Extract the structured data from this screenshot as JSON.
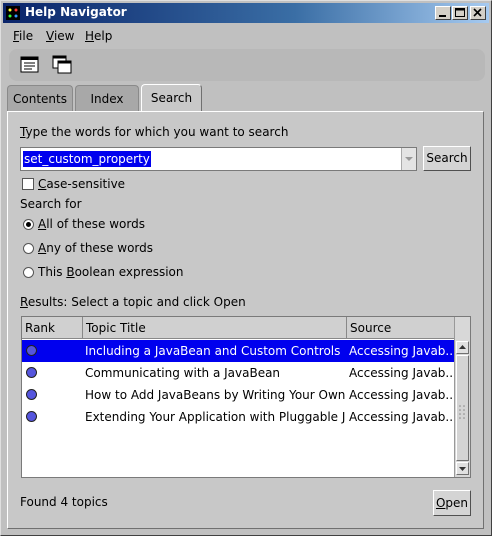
{
  "window": {
    "title": "Help Navigator",
    "colors": {
      "titlebar_start": "#0a246a",
      "selection": "#0000ee",
      "background": "#c0c0c0"
    }
  },
  "menubar": {
    "items": [
      {
        "label": "File",
        "mnemonic": "F",
        "rest": "ile"
      },
      {
        "label": "View",
        "mnemonic": "V",
        "rest": "iew"
      },
      {
        "label": "Help",
        "mnemonic": "H",
        "rest": "elp"
      }
    ]
  },
  "toolbar": {
    "icons": [
      "doc-window-icon",
      "cascade-windows-icon"
    ]
  },
  "tabs": [
    {
      "label": "Contents",
      "active": false
    },
    {
      "label": "Index",
      "active": false
    },
    {
      "label": "Search",
      "active": true
    }
  ],
  "search": {
    "prompt_mnemonic": "T",
    "prompt_rest": "ype the words for which you want to search",
    "query": "set_custom_property",
    "search_button": "Search",
    "case_sensitive": {
      "mnemonic": "C",
      "rest": "ase-sensitive",
      "checked": false
    },
    "search_for_label": "Search for",
    "options": [
      {
        "pre": "",
        "mnemonic": "A",
        "rest": "ll of these words",
        "selected": true
      },
      {
        "pre": "",
        "mnemonic": "A",
        "rest": "ny of these words",
        "selected": false
      },
      {
        "pre": "This ",
        "mnemonic": "B",
        "rest": "oolean expression",
        "selected": false
      }
    ]
  },
  "results": {
    "label_mnemonic": "R",
    "label_rest": "esults: Select a topic and click Open",
    "columns": [
      "Rank",
      "Topic Title",
      "Source"
    ],
    "rows": [
      {
        "title": "Including a JavaBean and Custom Controls",
        "source": "Accessing Javab...",
        "selected": true
      },
      {
        "title": "Communicating with a JavaBean",
        "source": "Accessing Javab...",
        "selected": false
      },
      {
        "title": "How to Add JavaBeans by Writing Your Own Java",
        "source": "Accessing Javab...",
        "selected": false
      },
      {
        "title": "Extending Your Application with Pluggable Java",
        "source": "Accessing Javab...",
        "selected": false
      }
    ],
    "status": "Found 4 topics",
    "open_button": "Open"
  }
}
